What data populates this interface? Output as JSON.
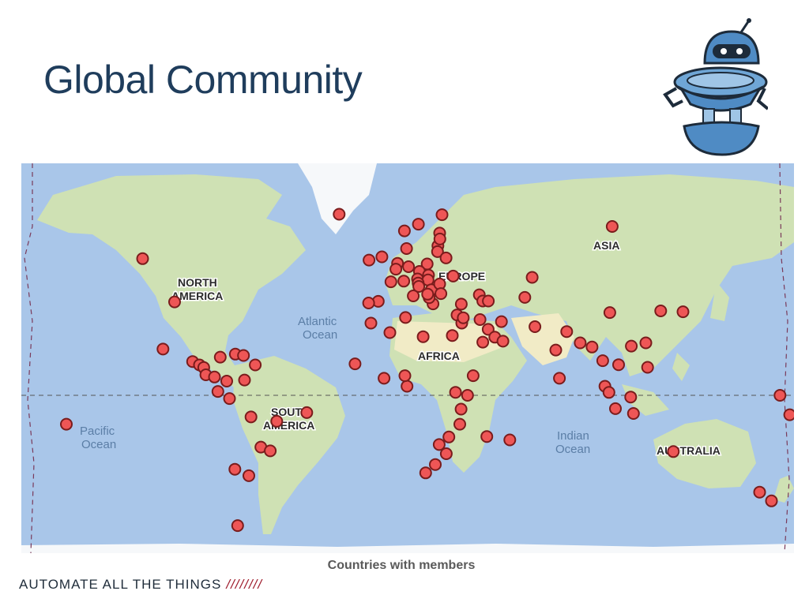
{
  "slide": {
    "title": "Global Community",
    "caption": "Countries with members",
    "footer_tagline": "AUTOMATE ALL THE THINGS",
    "footer_slashes": "////////"
  },
  "colors": {
    "ocean": "#a9c6e9",
    "land": "#cfe1b4",
    "desert": "#f1ebc6",
    "ice": "#f6f8fa",
    "marker_fill": "#ee5656",
    "marker_stroke": "#7a1c1c",
    "title": "#1f3d5c"
  },
  "mascot": {
    "icon": "robot-mascot-icon"
  },
  "map": {
    "continent_labels": [
      {
        "id": "north-america",
        "lines": [
          "NORTH",
          "AMERICA"
        ]
      },
      {
        "id": "south-america",
        "lines": [
          "SOUTH",
          "AMERICA"
        ]
      },
      {
        "id": "africa",
        "lines": [
          "AFRICA"
        ]
      },
      {
        "id": "asia",
        "lines": [
          "ASIA"
        ]
      },
      {
        "id": "europe",
        "lines": [
          "EUROPE"
        ]
      },
      {
        "id": "australia",
        "lines": [
          "AUSTRALIA"
        ]
      }
    ],
    "ocean_labels": [
      {
        "id": "atlantic",
        "lines": [
          "Atlantic",
          "Ocean"
        ]
      },
      {
        "id": "pacific",
        "lines": [
          "Pacific",
          "Ocean"
        ]
      },
      {
        "id": "indian",
        "lines": [
          "Indian",
          "Ocean"
        ]
      }
    ],
    "markers": [
      {
        "lat": 64.1,
        "lon": -21.9
      },
      {
        "lat": 53.5,
        "lon": -113.5
      },
      {
        "lat": 39.8,
        "lon": -98.6
      },
      {
        "lat": 21.0,
        "lon": -104.0
      },
      {
        "lat": 15.5,
        "lon": -90.2
      },
      {
        "lat": 14.0,
        "lon": -87.0
      },
      {
        "lat": 12.8,
        "lon": -85.0
      },
      {
        "lat": 17.5,
        "lon": -77.3
      },
      {
        "lat": 18.8,
        "lon": -70.3
      },
      {
        "lat": 18.2,
        "lon": -66.5
      },
      {
        "lat": 14.0,
        "lon": -61.0
      },
      {
        "lat": 9.5,
        "lon": -84.0
      },
      {
        "lat": 8.5,
        "lon": -80.0
      },
      {
        "lat": 6.6,
        "lon": -74.3
      },
      {
        "lat": 7.1,
        "lon": -66.0
      },
      {
        "lat": 1.8,
        "lon": -78.4
      },
      {
        "lat": -1.5,
        "lon": -73.0
      },
      {
        "lat": -10.0,
        "lon": -63.0
      },
      {
        "lat": -12.0,
        "lon": -51.0
      },
      {
        "lat": -8.0,
        "lon": -37.0
      },
      {
        "lat": -23.4,
        "lon": -58.4
      },
      {
        "lat": -25.0,
        "lon": -54.0
      },
      {
        "lat": -32.5,
        "lon": -70.5
      },
      {
        "lat": -35.0,
        "lon": -64.0
      },
      {
        "lat": -51.7,
        "lon": -69.2
      },
      {
        "lat": 4.2,
        "lon": 9.7
      },
      {
        "lat": 0.0,
        "lon": -176.5
      },
      {
        "lat": -9.0,
        "lon": -172.0
      },
      {
        "lat": -13.3,
        "lon": -149.0
      },
      {
        "lat": -41.0,
        "lon": 174.0
      },
      {
        "lat": -44.0,
        "lon": 179.5
      },
      {
        "lat": 60.5,
        "lon": 8.5
      },
      {
        "lat": 62.0,
        "lon": 15.0
      },
      {
        "lat": 64.0,
        "lon": 26.0
      },
      {
        "lat": 60.0,
        "lon": 24.9
      },
      {
        "lat": 56.9,
        "lon": 24.1
      },
      {
        "lat": 55.4,
        "lon": 23.9
      },
      {
        "lat": 58.6,
        "lon": 25.0
      },
      {
        "lat": 54.0,
        "lon": -2.0
      },
      {
        "lat": 53.1,
        "lon": -8.0
      },
      {
        "lat": 56.2,
        "lon": 9.5
      },
      {
        "lat": 52.2,
        "lon": 5.3
      },
      {
        "lat": 50.5,
        "lon": 4.5
      },
      {
        "lat": 51.2,
        "lon": 10.4
      },
      {
        "lat": 52.0,
        "lon": 19.1
      },
      {
        "lat": 49.8,
        "lon": 15.5
      },
      {
        "lat": 48.7,
        "lon": 19.7
      },
      {
        "lat": 47.5,
        "lon": 14.6
      },
      {
        "lat": 47.2,
        "lon": 19.5
      },
      {
        "lat": 46.8,
        "lon": 8.2
      },
      {
        "lat": 46.6,
        "lon": 2.2
      },
      {
        "lat": 46.2,
        "lon": 14.9
      },
      {
        "lat": 45.1,
        "lon": 15.2
      },
      {
        "lat": 44.0,
        "lon": 21.0
      },
      {
        "lat": 45.9,
        "lon": 24.9
      },
      {
        "lat": 42.7,
        "lon": 25.5
      },
      {
        "lat": 48.4,
        "lon": 31.2
      },
      {
        "lat": 53.7,
        "lon": 27.9
      },
      {
        "lat": 41.9,
        "lon": 12.6
      },
      {
        "lat": 40.0,
        "lon": -3.7
      },
      {
        "lat": 39.4,
        "lon": -8.2
      },
      {
        "lat": 39.1,
        "lon": 21.8
      },
      {
        "lat": 41.3,
        "lon": 20.0
      },
      {
        "lat": 42.5,
        "lon": 19.3
      },
      {
        "lat": 35.0,
        "lon": 33.0
      },
      {
        "lat": 39.0,
        "lon": 35.0
      },
      {
        "lat": 42.3,
        "lon": 43.4
      },
      {
        "lat": 40.1,
        "lon": 45.0
      },
      {
        "lat": 40.1,
        "lon": 47.6
      },
      {
        "lat": 48.0,
        "lon": 68.0
      },
      {
        "lat": 61.5,
        "lon": 105.3
      },
      {
        "lat": 41.4,
        "lon": 64.6
      },
      {
        "lat": 32.4,
        "lon": 53.7
      },
      {
        "lat": 30.4,
        "lon": 69.3
      },
      {
        "lat": 28.4,
        "lon": 84.1
      },
      {
        "lat": 20.6,
        "lon": 79.0
      },
      {
        "lat": 23.7,
        "lon": 90.4
      },
      {
        "lat": 21.9,
        "lon": 95.9
      },
      {
        "lat": 15.9,
        "lon": 100.9
      },
      {
        "lat": 14.1,
        "lon": 108.3
      },
      {
        "lat": 7.9,
        "lon": 80.7
      },
      {
        "lat": 35.9,
        "lon": 104.2
      },
      {
        "lat": 36.5,
        "lon": 127.9
      },
      {
        "lat": 36.2,
        "lon": 138.3
      },
      {
        "lat": 23.7,
        "lon": 121.0
      },
      {
        "lat": 22.3,
        "lon": 114.2
      },
      {
        "lat": 12.9,
        "lon": 121.8
      },
      {
        "lat": 4.2,
        "lon": 101.9
      },
      {
        "lat": 1.35,
        "lon": 103.8
      },
      {
        "lat": -0.8,
        "lon": 113.9
      },
      {
        "lat": -6.2,
        "lon": 106.8
      },
      {
        "lat": -8.4,
        "lon": 115.2
      },
      {
        "lat": -25.3,
        "lon": 133.8
      },
      {
        "lat": 31.8,
        "lon": 35.2
      },
      {
        "lat": 33.9,
        "lon": 35.9
      },
      {
        "lat": 33.2,
        "lon": 43.7
      },
      {
        "lat": 29.3,
        "lon": 47.5
      },
      {
        "lat": 26.1,
        "lon": 50.6
      },
      {
        "lat": 24.0,
        "lon": 45.0
      },
      {
        "lat": 24.4,
        "lon": 54.4
      },
      {
        "lat": 26.8,
        "lon": 30.8
      },
      {
        "lat": 26.3,
        "lon": 17.2
      },
      {
        "lat": 34.0,
        "lon": 9.0
      },
      {
        "lat": 28.0,
        "lon": 1.7
      },
      {
        "lat": 31.8,
        "lon": -7.1
      },
      {
        "lat": 14.5,
        "lon": -14.5
      },
      {
        "lat": 7.9,
        "lon": -1.0
      },
      {
        "lat": 9.1,
        "lon": 8.7
      },
      {
        "lat": 9.1,
        "lon": 40.5
      },
      {
        "lat": 1.4,
        "lon": 32.3
      },
      {
        "lat": -0.0,
        "lon": 37.9
      },
      {
        "lat": -6.4,
        "lon": 34.9
      },
      {
        "lat": -13.3,
        "lon": 34.3
      },
      {
        "lat": -19.0,
        "lon": 29.2
      },
      {
        "lat": -22.3,
        "lon": 24.7
      },
      {
        "lat": -30.6,
        "lon": 22.9
      },
      {
        "lat": -33.9,
        "lon": 18.4
      },
      {
        "lat": -26.2,
        "lon": 28.0
      },
      {
        "lat": -18.8,
        "lon": 46.9
      },
      {
        "lat": -20.3,
        "lon": 57.6
      }
    ]
  }
}
